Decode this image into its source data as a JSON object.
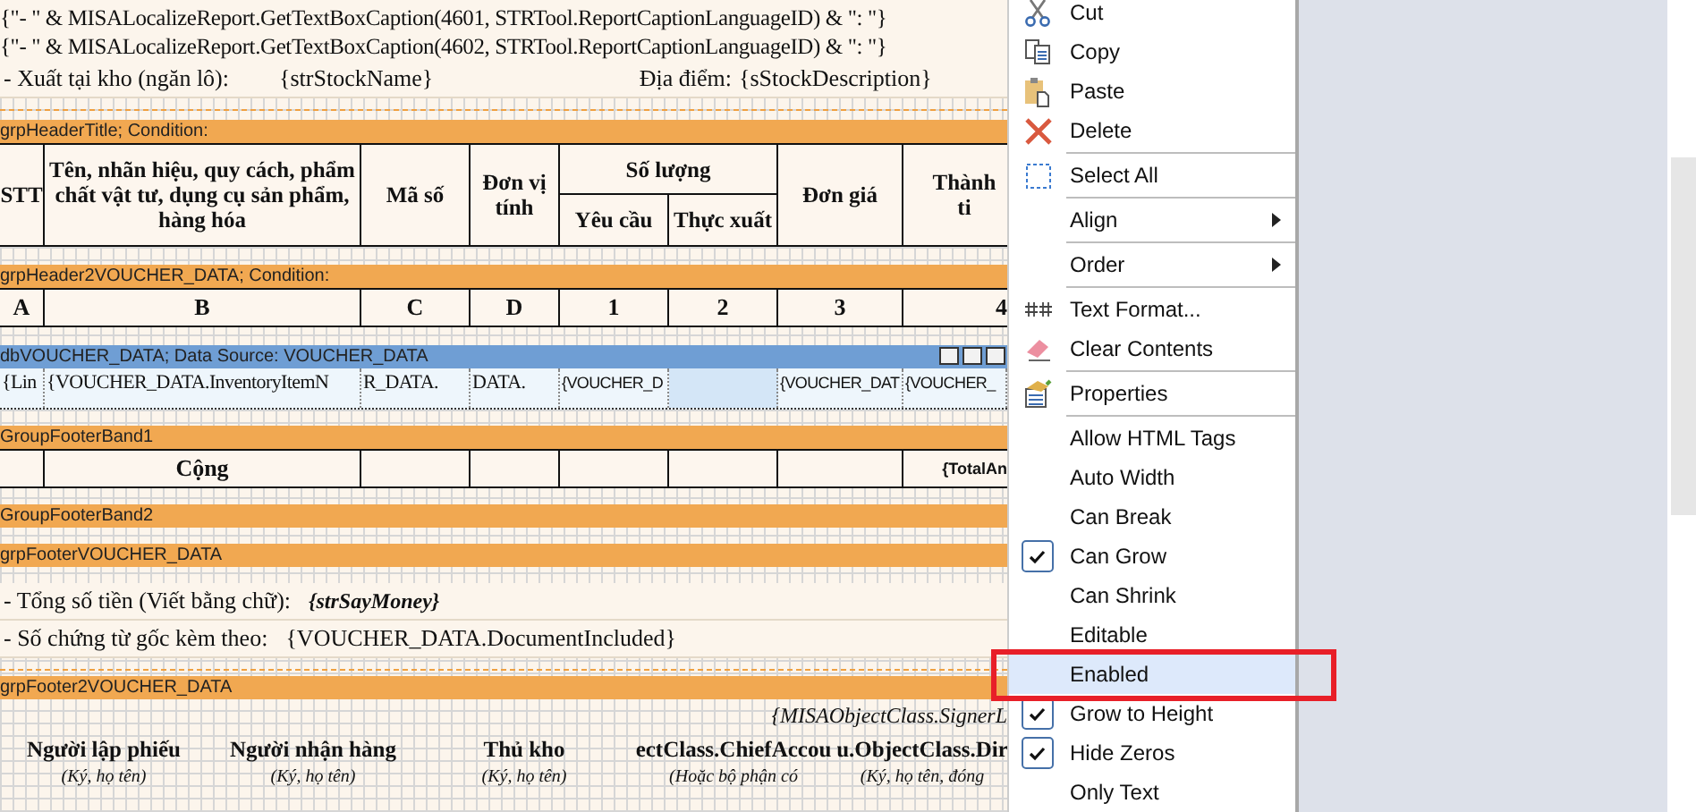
{
  "report": {
    "top_lines": [
      "{\"- \" & MISALocalizeReport.GetTextBoxCaption(4601, STRTool.ReportCaptionLanguageID) & \": \"}",
      "{\"- \" & MISALocalizeReport.GetTextBoxCaption(4602, STRTool.ReportCaptionLanguageID) & \": \"}"
    ],
    "stock_row": {
      "label": "- Xuất tại kho (ngăn lô):",
      "value": "{strStockName}",
      "location_label": "Địa điểm:",
      "location_value": "{sStockDescription}"
    },
    "header_band": "grpHeaderTitle; Condition:",
    "header_table": {
      "stt": "STT",
      "name": "Tên, nhãn hiệu, quy cách, phẩm chất vật tư, dụng cụ sản phẩm, hàng hóa",
      "code": "Mã số",
      "unit": "Đơn vị tính",
      "quantity": "Số lượng",
      "requested": "Yêu cầu",
      "issued": "Thực xuất",
      "price": "Đơn giá",
      "amount": "Thành ti"
    },
    "letters_band": "grpHeader2VOUCHER_DATA; Condition:",
    "letters": [
      "A",
      "B",
      "C",
      "D",
      "1",
      "2",
      "3",
      "4"
    ],
    "data_band": "dbVOUCHER_DATA; Data Source: VOUCHER_DATA",
    "data_cells": [
      {
        "text": "{Lin",
        "selected": false
      },
      {
        "text": "{VOUCHER_DATA.InventoryItemN",
        "selected": false
      },
      {
        "text": "R_DATA.",
        "selected": false
      },
      {
        "text": "DATA.",
        "selected": false
      },
      {
        "text": "{VOUCHER_D",
        "selected": false
      },
      {
        "text": "",
        "selected": true
      },
      {
        "text": "{VOUCHER_DAT",
        "selected": false
      },
      {
        "text": "{VOUCHER_",
        "selected": false
      }
    ],
    "footer_band_1": "GroupFooterBand1",
    "total_row": {
      "label": "Cộng",
      "amount": "{TotalAn"
    },
    "footer_band_2": "GroupFooterBand2",
    "footer_band_3": "grpFooterVOUCHER_DATA",
    "say_money": {
      "label": "- Tổng số tiền (Viết bằng chữ):",
      "value": "{strSayMoney}"
    },
    "documents": {
      "label": "- Số chứng từ gốc kèm theo:",
      "value": "{VOUCHER_DATA.DocumentIncluded}"
    },
    "footer_band_4": "grpFooter2VOUCHER_DATA",
    "signer": "{MISAObjectClass.SignerL",
    "signatures": [
      {
        "title": "Người lập phiếu",
        "note": "(Ký, họ tên)"
      },
      {
        "title": "Người nhận hàng",
        "note": "(Ký, họ tên)"
      },
      {
        "title": "Thủ kho",
        "note": "(Ký, họ tên)"
      },
      {
        "title": "ectClass.ChiefAccou",
        "note": "(Hoặc bộ phận có"
      },
      {
        "title": "u.ObjectClass.Dir",
        "note": "(Ký, họ tên, đóng"
      }
    ]
  },
  "context_menu": [
    {
      "kind": "item",
      "label": "Cut",
      "checked": false,
      "selected": false,
      "submenu": false,
      "annotated": false
    },
    {
      "kind": "item",
      "label": "Copy",
      "checked": false,
      "selected": false,
      "submenu": false,
      "annotated": false
    },
    {
      "kind": "item",
      "label": "Paste",
      "checked": false,
      "selected": false,
      "submenu": false,
      "annotated": false
    },
    {
      "kind": "item",
      "label": "Delete",
      "checked": false,
      "selected": false,
      "submenu": false,
      "annotated": false
    },
    {
      "kind": "separator"
    },
    {
      "kind": "item",
      "label": "Select All",
      "checked": false,
      "selected": false,
      "submenu": false,
      "annotated": false
    },
    {
      "kind": "separator"
    },
    {
      "kind": "item",
      "label": "Align",
      "checked": false,
      "selected": false,
      "submenu": true,
      "annotated": false
    },
    {
      "kind": "separator"
    },
    {
      "kind": "item",
      "label": "Order",
      "checked": false,
      "selected": false,
      "submenu": true,
      "annotated": false
    },
    {
      "kind": "separator"
    },
    {
      "kind": "item",
      "label": "Text Format...",
      "checked": false,
      "selected": false,
      "submenu": false,
      "annotated": false
    },
    {
      "kind": "item",
      "label": "Clear Contents",
      "checked": false,
      "selected": false,
      "submenu": false,
      "annotated": false
    },
    {
      "kind": "separator"
    },
    {
      "kind": "item",
      "label": "Properties",
      "checked": false,
      "selected": false,
      "submenu": false,
      "annotated": false
    },
    {
      "kind": "separator"
    },
    {
      "kind": "item",
      "label": "Allow HTML Tags",
      "checked": false,
      "selected": false,
      "submenu": false,
      "annotated": false
    },
    {
      "kind": "item",
      "label": "Auto Width",
      "checked": false,
      "selected": false,
      "submenu": false,
      "annotated": false
    },
    {
      "kind": "item",
      "label": "Can Break",
      "checked": false,
      "selected": false,
      "submenu": false,
      "annotated": false
    },
    {
      "kind": "item",
      "label": "Can Grow",
      "checked": true,
      "selected": false,
      "submenu": false,
      "annotated": false
    },
    {
      "kind": "item",
      "label": "Can Shrink",
      "checked": false,
      "selected": false,
      "submenu": false,
      "annotated": false
    },
    {
      "kind": "item",
      "label": "Editable",
      "checked": false,
      "selected": false,
      "submenu": false,
      "annotated": false
    },
    {
      "kind": "item",
      "label": "Enabled",
      "checked": false,
      "selected": true,
      "submenu": false,
      "annotated": true
    },
    {
      "kind": "item",
      "label": "Grow to Height",
      "checked": true,
      "selected": false,
      "submenu": false,
      "annotated": false
    },
    {
      "kind": "item",
      "label": "Hide Zeros",
      "checked": true,
      "selected": false,
      "submenu": false,
      "annotated": false
    },
    {
      "kind": "item",
      "label": "Only Text",
      "checked": false,
      "selected": false,
      "submenu": false,
      "annotated": false
    }
  ]
}
